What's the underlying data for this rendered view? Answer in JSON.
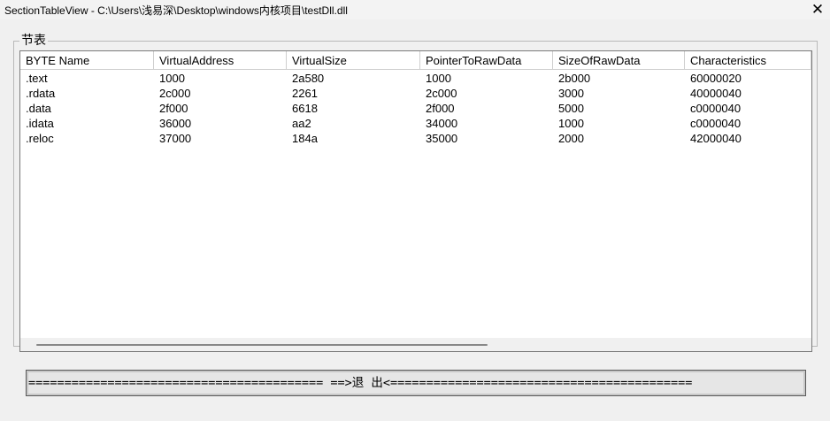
{
  "window": {
    "title": "SectionTableView - C:\\Users\\浅易深\\Desktop\\windows内核项目\\testDll.dll",
    "close_glyph": "✕"
  },
  "group": {
    "label": "节表"
  },
  "table": {
    "columns": [
      "BYTE Name",
      "VirtualAddress",
      "VirtualSize",
      "PointerToRawData",
      "SizeOfRawData",
      "Characteristics"
    ],
    "rows": [
      [
        ".text",
        "1000",
        "2a580",
        "1000",
        "2b000",
        "60000020"
      ],
      [
        ".rdata",
        "2c000",
        "2261",
        "2c000",
        "3000",
        "40000040"
      ],
      [
        ".data",
        "2f000",
        "6618",
        "2f000",
        "5000",
        "c0000040"
      ],
      [
        ".idata",
        "36000",
        "aa2",
        "34000",
        "1000",
        "c0000040"
      ],
      [
        ".reloc",
        "37000",
        "184a",
        "35000",
        "2000",
        "42000040"
      ]
    ]
  },
  "exit_button": {
    "label": "========================================= ==>退    出<=========================================="
  }
}
